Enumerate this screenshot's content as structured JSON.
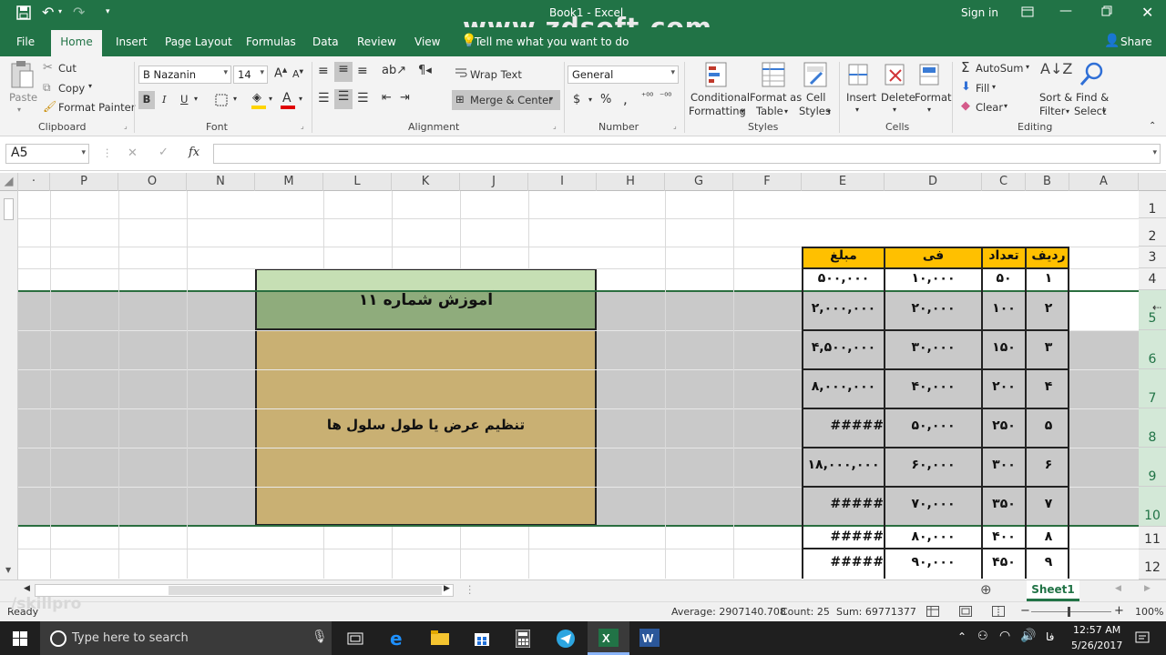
{
  "titlebar": {
    "doc_title": "Book1 - Excel",
    "sign_in": "Sign in",
    "watermark": "www.zdsoft.com"
  },
  "tabs": {
    "file": "File",
    "home": "Home",
    "insert": "Insert",
    "page_layout": "Page Layout",
    "formulas": "Formulas",
    "data": "Data",
    "review": "Review",
    "view": "View",
    "tell_me": "Tell me what you want to do",
    "share": "Share"
  },
  "clipboard": {
    "paste": "Paste",
    "cut": "Cut",
    "copy": "Copy",
    "format_painter": "Format Painter",
    "group": "Clipboard"
  },
  "font": {
    "name": "B Nazanin",
    "size": "14",
    "bold": "B",
    "italic": "I",
    "underline": "U",
    "group": "Font"
  },
  "alignment": {
    "wrap_text": "Wrap Text",
    "merge_center": "Merge & Center",
    "group": "Alignment"
  },
  "number": {
    "format": "General",
    "currency": "$",
    "percent": "%",
    "comma": ",",
    "group": "Number"
  },
  "styles": {
    "conditional": "Conditional",
    "formatting": "Formatting",
    "format_as": "Format as",
    "table": "Table",
    "cell": "Cell",
    "cell_styles": "Styles",
    "group": "Styles"
  },
  "cells": {
    "insert": "Insert",
    "delete": "Delete",
    "format": "Format",
    "group": "Cells"
  },
  "editing": {
    "autosum": "AutoSum",
    "fill": "Fill",
    "clear": "Clear",
    "sort": "Sort &",
    "filter": "Filter",
    "find": "Find &",
    "select": "Select",
    "group": "Editing"
  },
  "formula_bar": {
    "name_box": "A5",
    "fx": "fx",
    "cancel": "✕",
    "enter": "✓"
  },
  "columns": [
    "P",
    "O",
    "N",
    "M",
    "L",
    "K",
    "J",
    "I",
    "H",
    "G",
    "F",
    "E",
    "D",
    "C",
    "B",
    "A"
  ],
  "rows": [
    "1",
    "2",
    "3",
    "4",
    "5",
    "6",
    "7",
    "8",
    "9",
    "10",
    "11",
    "12"
  ],
  "table": {
    "headers": {
      "radif": "ردیف",
      "tedad": "تعداد",
      "fi": "فی",
      "mablagh": "مبلغ"
    },
    "rows": [
      {
        "radif": "۱",
        "tedad": "۵۰",
        "fi": "۱۰,۰۰۰",
        "mablagh": "۵۰۰,۰۰۰"
      },
      {
        "radif": "۲",
        "tedad": "۱۰۰",
        "fi": "۲۰,۰۰۰",
        "mablagh": "۲,۰۰۰,۰۰۰"
      },
      {
        "radif": "۳",
        "tedad": "۱۵۰",
        "fi": "۳۰,۰۰۰",
        "mablagh": "۴,۵۰۰,۰۰۰"
      },
      {
        "radif": "۴",
        "tedad": "۲۰۰",
        "fi": "۴۰,۰۰۰",
        "mablagh": "۸,۰۰۰,۰۰۰"
      },
      {
        "radif": "۵",
        "tedad": "۲۵۰",
        "fi": "۵۰,۰۰۰",
        "mablagh": "#####"
      },
      {
        "radif": "۶",
        "tedad": "۳۰۰",
        "fi": "۶۰,۰۰۰",
        "mablagh": "۱۸,۰۰۰,۰۰۰"
      },
      {
        "radif": "۷",
        "tedad": "۳۵۰",
        "fi": "۷۰,۰۰۰",
        "mablagh": "#####"
      },
      {
        "radif": "۸",
        "tedad": "۴۰۰",
        "fi": "۸۰,۰۰۰",
        "mablagh": "#####"
      },
      {
        "radif": "۹",
        "tedad": "۴۵۰",
        "fi": "۹۰,۰۰۰",
        "mablagh": "#####"
      }
    ]
  },
  "merged": {
    "title": "آموزش شماره ۱۱",
    "body": "تنظیم عرض یا طول سلول ها"
  },
  "sheet": {
    "tab": "Sheet1"
  },
  "status": {
    "ready": "Ready",
    "average": "Average: 2907140.708",
    "count": "Count: 25",
    "sum": "Sum: 69771377",
    "zoom": "100%"
  },
  "taskbar": {
    "search": "Type here to search",
    "time": "12:57 AM",
    "date": "5/26/2017",
    "lang": "فا"
  },
  "watermark2": "/skillpro",
  "colors": {
    "excel_green": "#217346",
    "header_orange": "#ffc000",
    "merged_title": "#8fac7c",
    "merged_body": "#c9b073",
    "selection_gray": "#c9c9c9"
  }
}
